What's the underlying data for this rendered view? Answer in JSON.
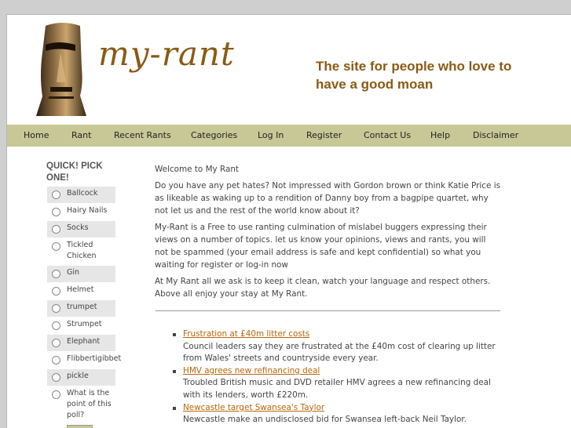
{
  "header": {
    "logo_text": "my-rant",
    "tagline": "The site for people who love to have a good moan"
  },
  "nav": [
    {
      "label": "Home"
    },
    {
      "label": "Rant"
    },
    {
      "label": "Recent Rants"
    },
    {
      "label": "Categories"
    },
    {
      "label": "Log In"
    },
    {
      "label": "Register"
    },
    {
      "label": "Contact Us"
    },
    {
      "label": "Help"
    },
    {
      "label": "Disclaimer"
    }
  ],
  "poll": {
    "title": "QUICK! PICK ONE!",
    "options": [
      {
        "label": "Ballcock"
      },
      {
        "label": "Hairy Nails"
      },
      {
        "label": "Socks"
      },
      {
        "label": "Tickled Chicken"
      },
      {
        "label": "Gin"
      },
      {
        "label": "Helmet"
      },
      {
        "label": "trumpet"
      },
      {
        "label": "Strumpet"
      },
      {
        "label": "Elephant"
      },
      {
        "label": "Flibbertigibbet"
      },
      {
        "label": "pickle"
      },
      {
        "label": "What is the point of this poll?"
      }
    ]
  },
  "main": {
    "welcome": "Welcome to My Rant",
    "para1": "Do you have any pet hates? Not impressed with Gordon brown or think Katie Price is as likeable as waking up to a rendition of Danny boy from a bagpipe quartet, why not let us and the rest of the world know about it?",
    "para2": "My-Rant is a Free to use ranting culmination of mislabel buggers expressing their views on a number of topics. let us know your opinions, views and rants, you will not be spammed (your email address is safe and kept confidential) so what you waiting for register or log-in now",
    "para3": "At My Rant all we ask is to keep it clean, watch your language and respect others. Above all enjoy your stay at My Rant."
  },
  "news": [
    {
      "title": "Frustration at £40m litter costs",
      "desc": "Council leaders say they are frustrated at the £40m cost of clearing up litter from Wales' streets and countryside every year."
    },
    {
      "title": "HMV agrees new refinancing deal",
      "desc": "Troubled British music and DVD retailer HMV agrees a new refinancing deal with its lenders, worth £220m."
    },
    {
      "title": "Newcastle target Swansea's Taylor",
      "desc": "Newcastle make an undisclosed bid for Swansea left-back Neil Taylor."
    }
  ]
}
